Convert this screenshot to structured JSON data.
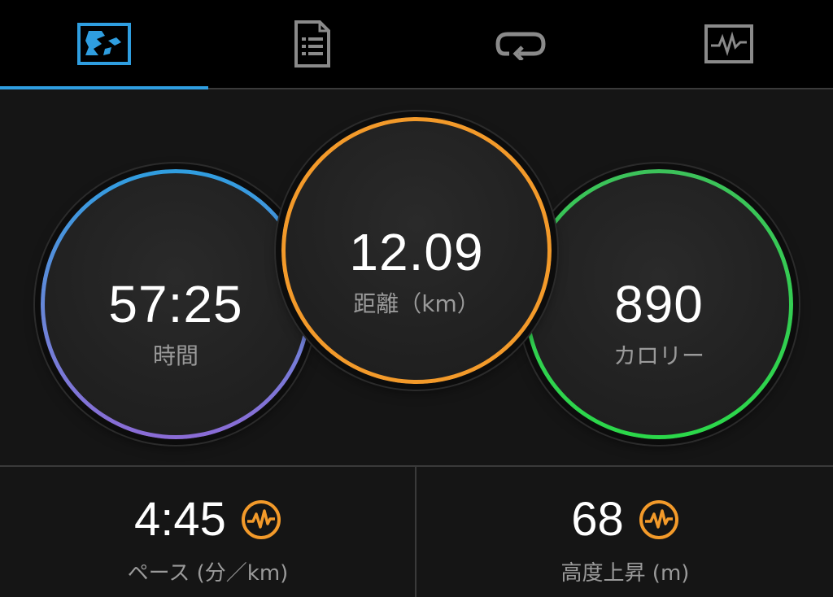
{
  "tabs": [
    {
      "id": "map",
      "icon": "map-icon",
      "active": true
    },
    {
      "id": "details",
      "icon": "document-list-icon",
      "active": false
    },
    {
      "id": "laps",
      "icon": "laps-loop-icon",
      "active": false
    },
    {
      "id": "charts",
      "icon": "chart-icon",
      "active": false
    }
  ],
  "colors": {
    "accent": "#2f9ee0",
    "time_ring_top": "#2f9ee0",
    "time_ring_bottom": "#8b6bd6",
    "distance_ring": "#f39a2a",
    "calories_ring": "#32d24a",
    "badge": "#f39a2a"
  },
  "summary": {
    "time": {
      "value": "57:25",
      "label": "時間"
    },
    "distance": {
      "value": "12.09",
      "label": "距離（km）"
    },
    "calories": {
      "value": "890",
      "label": "カロリー"
    }
  },
  "stats": {
    "pace": {
      "value": "4:45",
      "label": "ペース (分／km)",
      "icon": "activity-pulse-icon"
    },
    "elevation": {
      "value": "68",
      "label": "高度上昇 (m)",
      "icon": "activity-pulse-icon"
    }
  }
}
